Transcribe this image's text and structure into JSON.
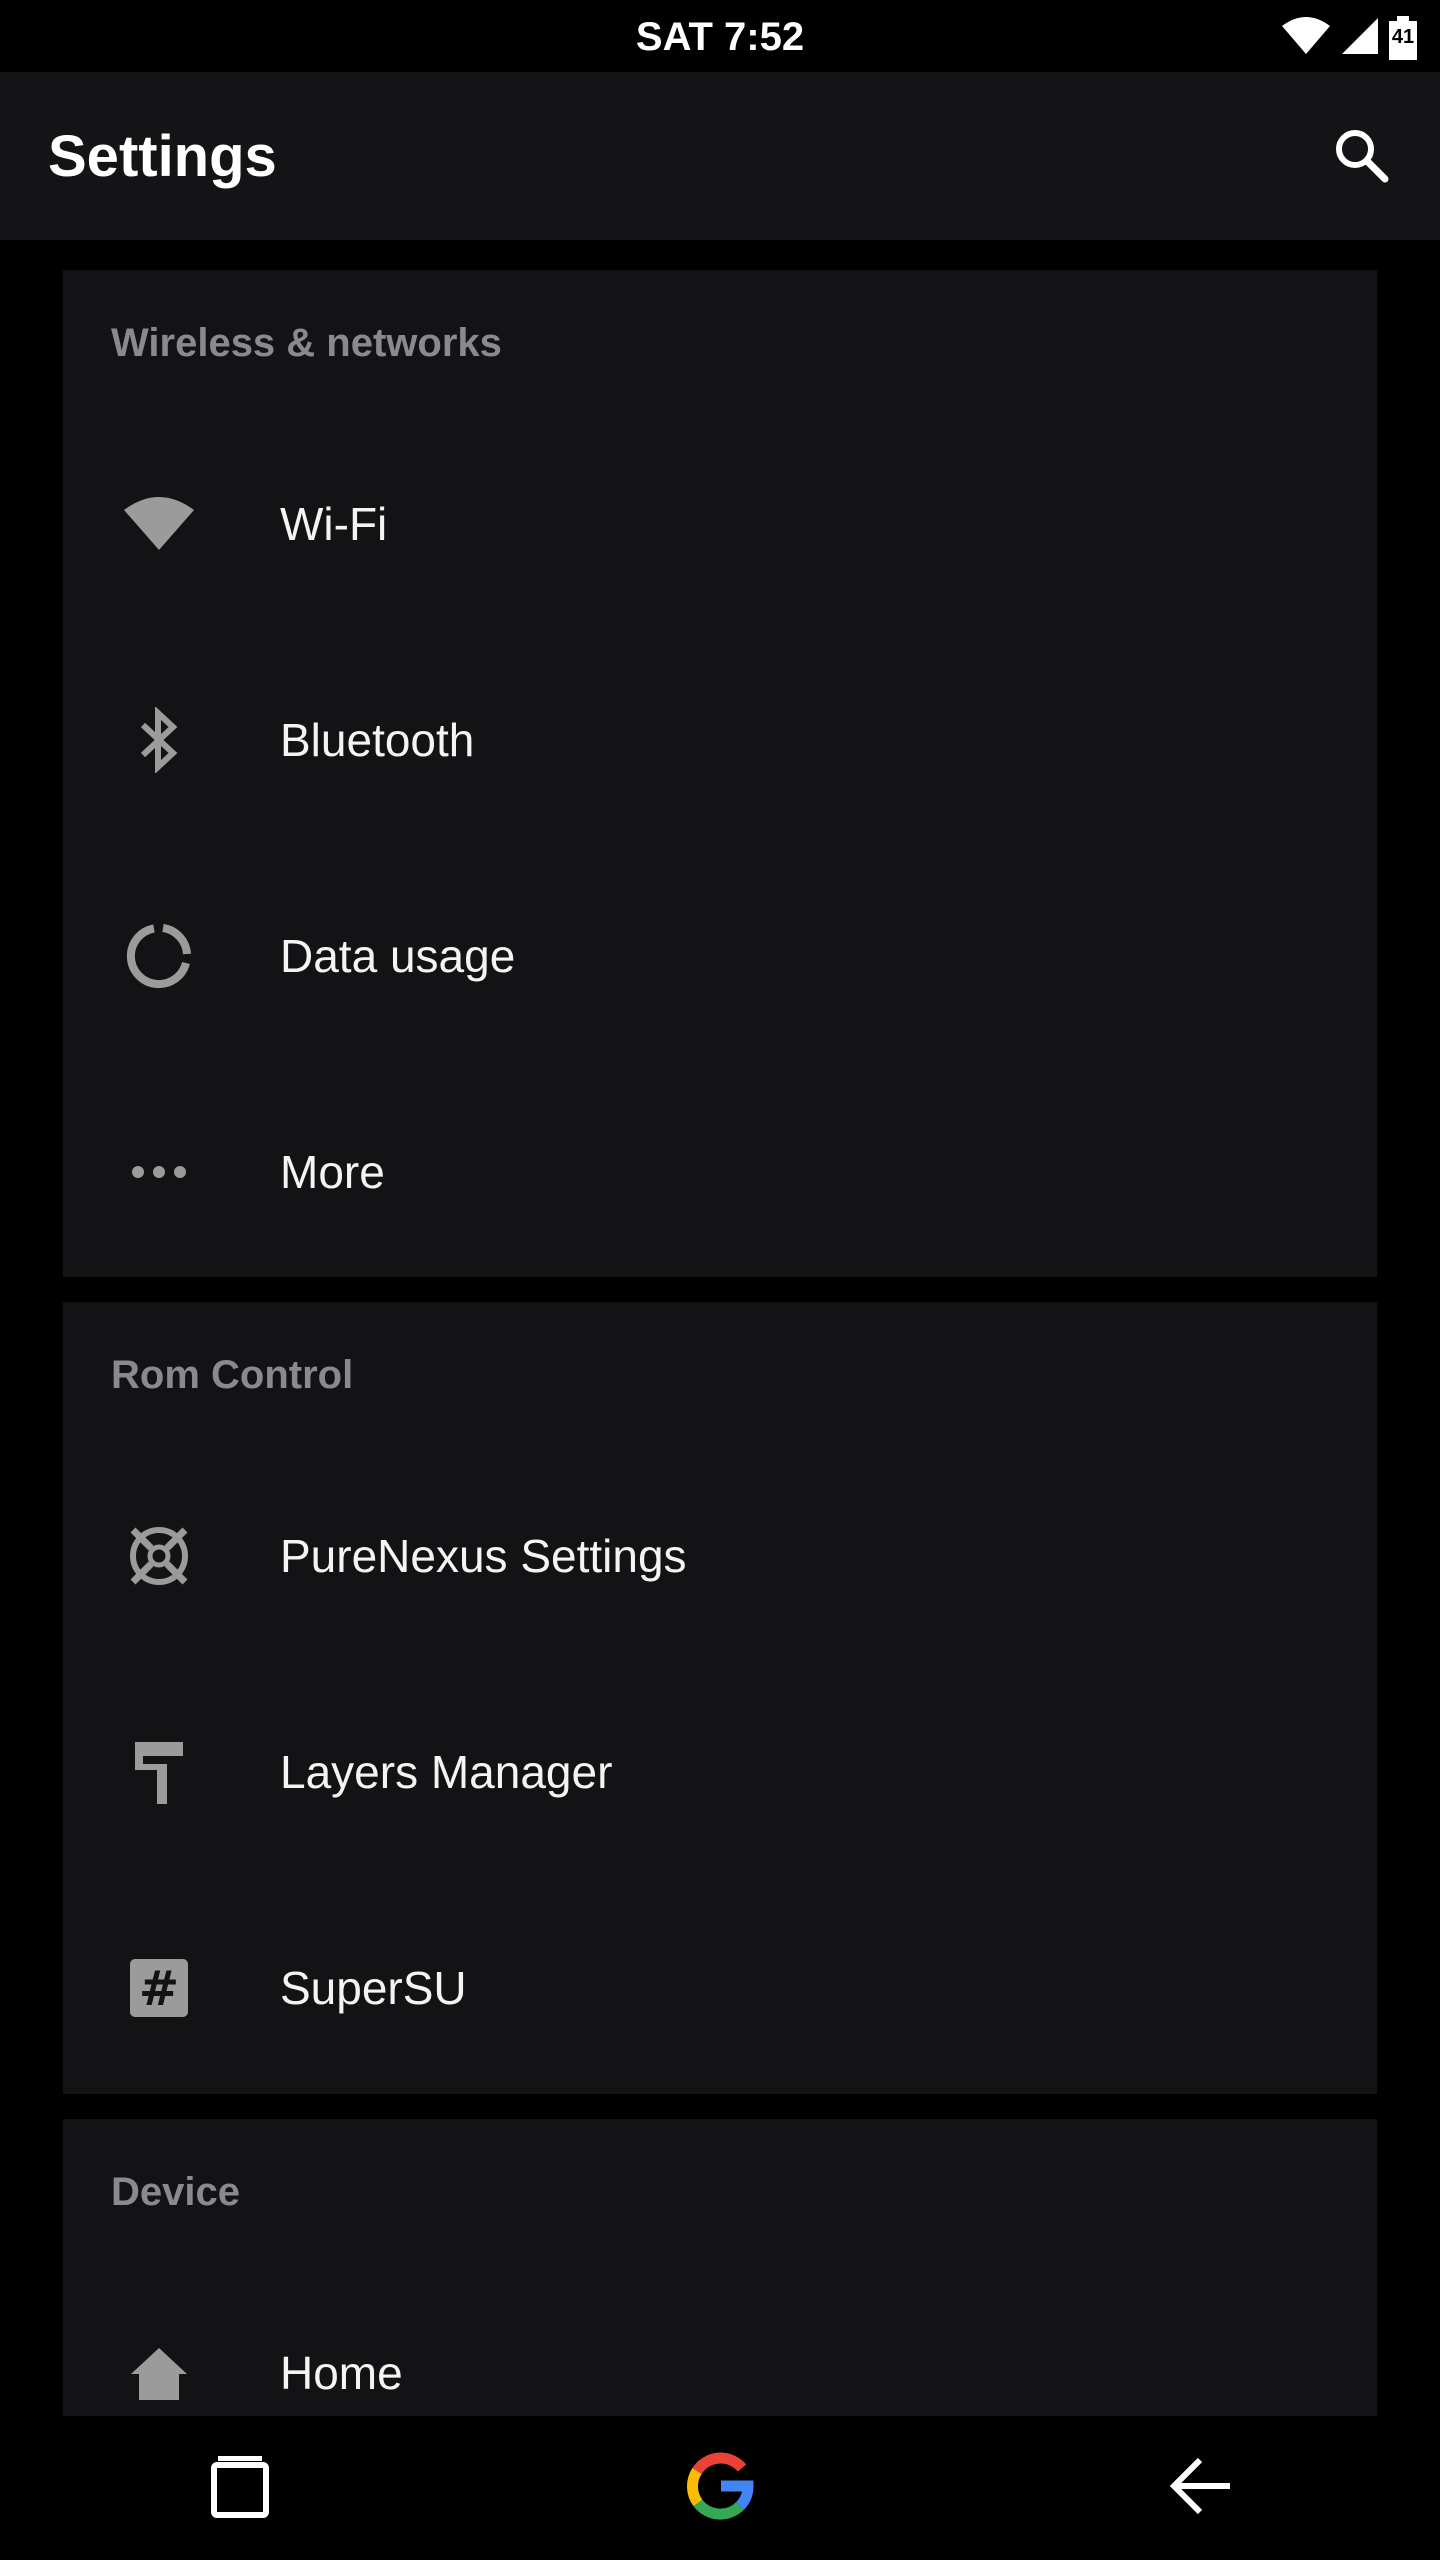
{
  "status_bar": {
    "time": "SAT 7:52",
    "battery_level": "41",
    "icons": [
      "wifi-icon",
      "cell-signal-icon",
      "battery-icon"
    ]
  },
  "app_bar": {
    "title": "Settings",
    "search_icon": "search-icon"
  },
  "sections": [
    {
      "header": "Wireless & networks",
      "items": [
        {
          "label": "Wi-Fi",
          "icon": "wifi-icon"
        },
        {
          "label": "Bluetooth",
          "icon": "bluetooth-icon"
        },
        {
          "label": "Data usage",
          "icon": "data-usage-icon"
        },
        {
          "label": "More",
          "icon": "more-dots-icon"
        }
      ]
    },
    {
      "header": "Rom Control",
      "items": [
        {
          "label": "PureNexus Settings",
          "icon": "purenexus-icon"
        },
        {
          "label": "Layers Manager",
          "icon": "paint-roller-icon"
        },
        {
          "label": "SuperSU",
          "icon": "supersu-hash-icon"
        }
      ]
    },
    {
      "header": "Device",
      "items": [
        {
          "label": "Home",
          "icon": "home-icon"
        }
      ]
    }
  ],
  "nav_bar": {
    "buttons": [
      "recents-icon",
      "google-icon",
      "back-icon"
    ]
  },
  "colors": {
    "background": "#000000",
    "app_bar": "#141416",
    "card": "#131316",
    "section_header": "#8a8a8e",
    "icon": "#9b9b9b",
    "text": "#f4f4f4"
  }
}
